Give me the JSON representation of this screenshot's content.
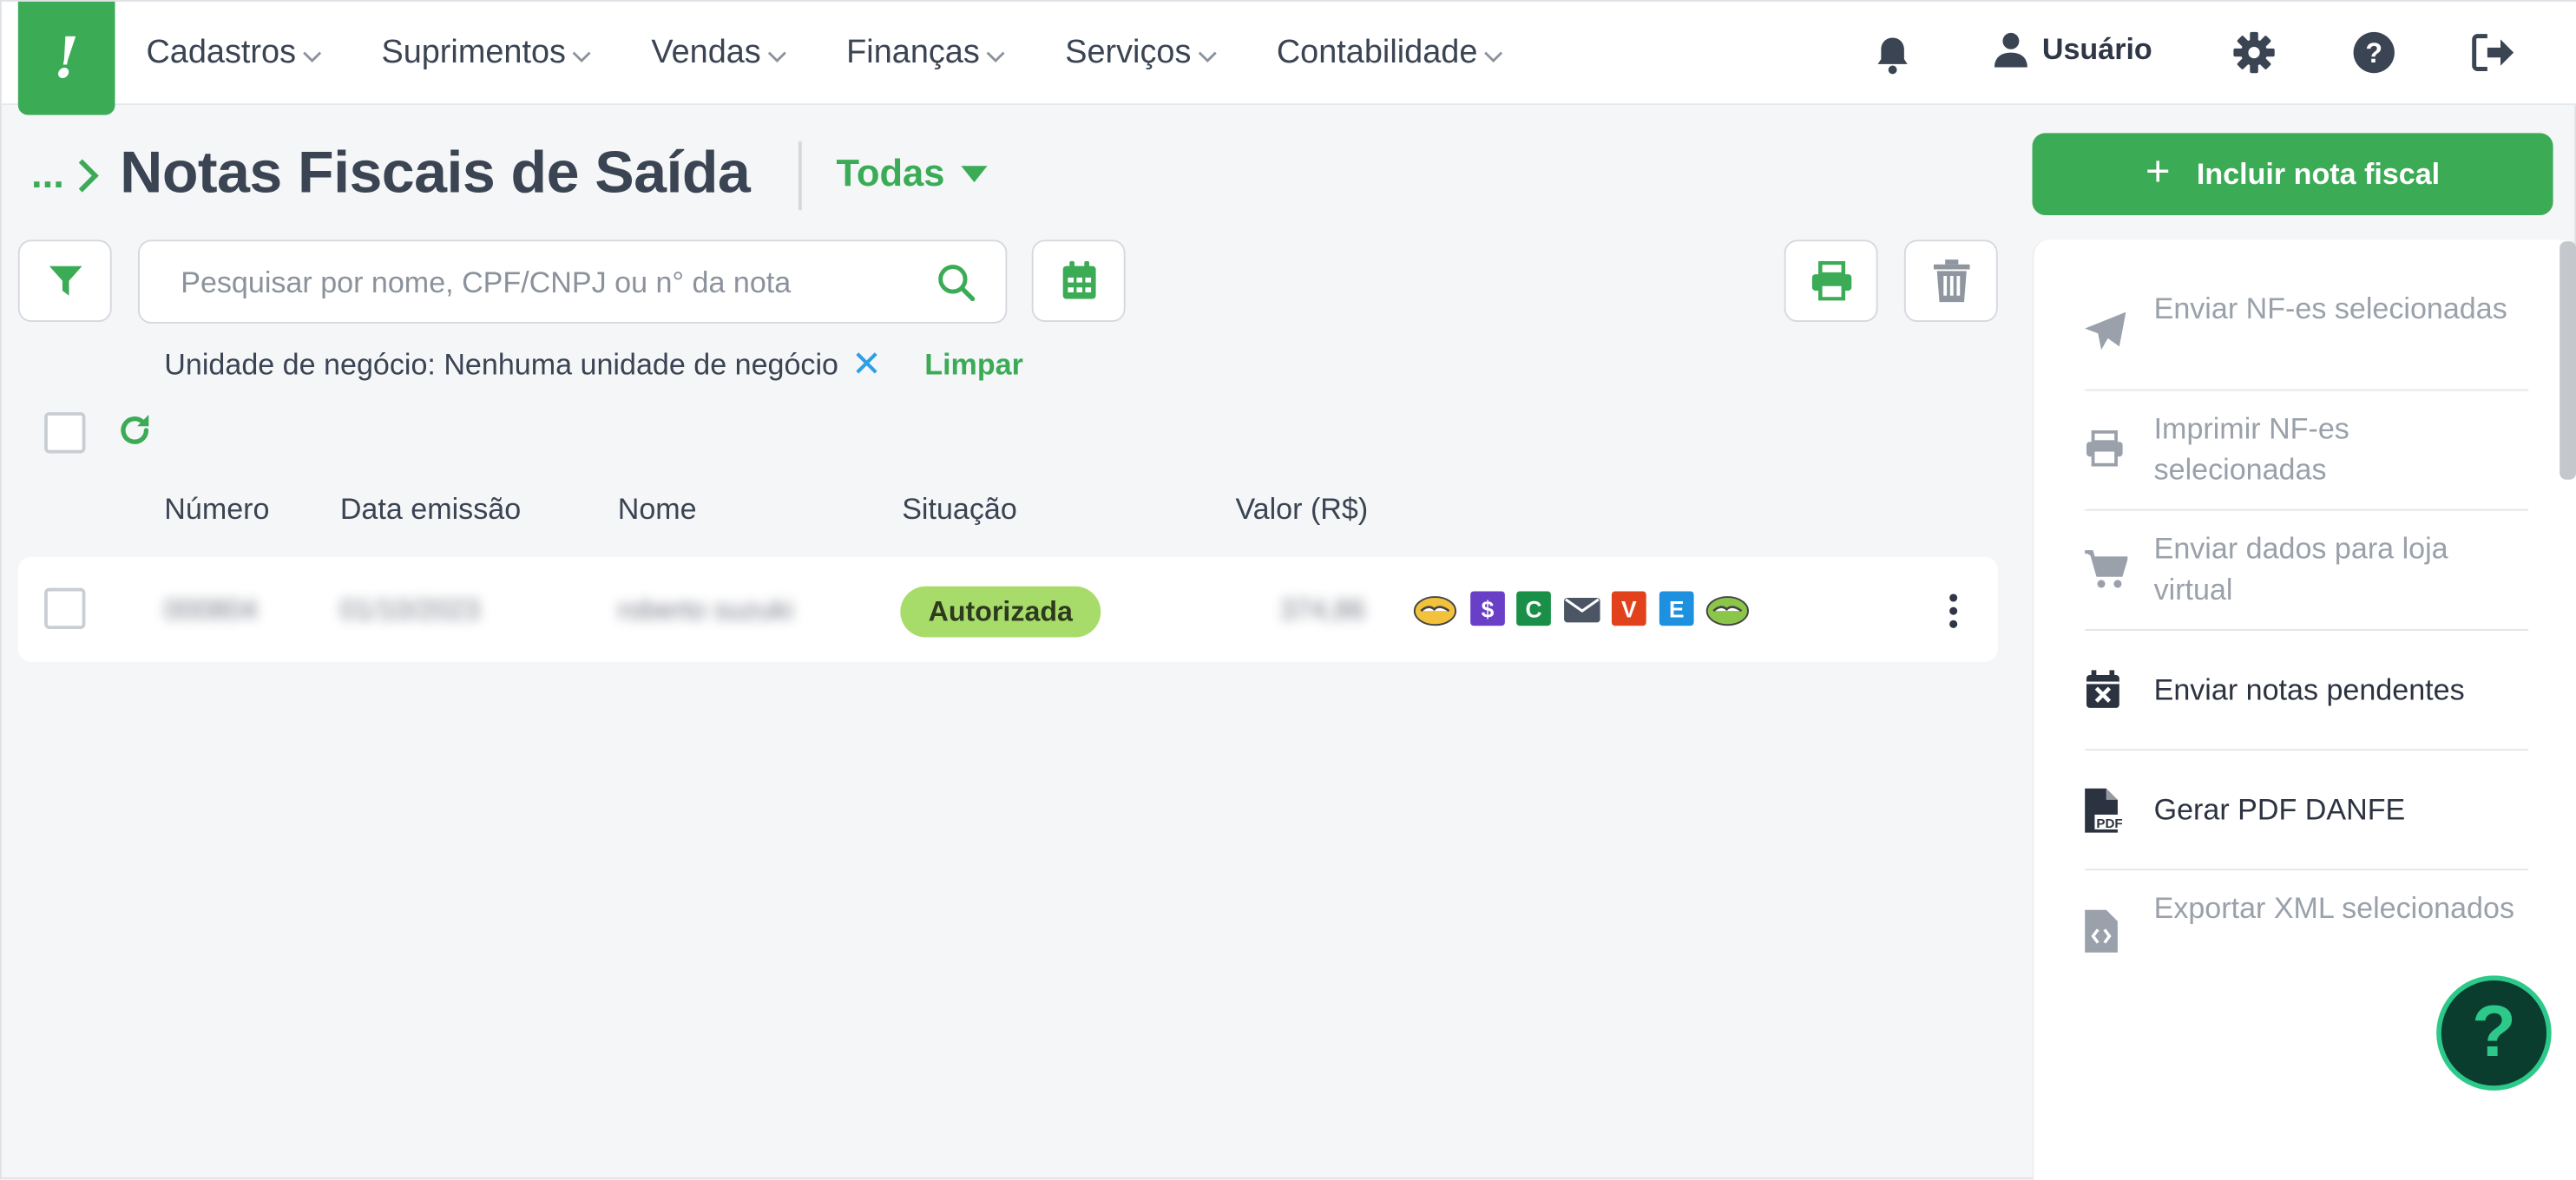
{
  "nav": {
    "logo_glyph": "!",
    "items": [
      {
        "label": "Cadastros"
      },
      {
        "label": "Suprimentos"
      },
      {
        "label": "Vendas"
      },
      {
        "label": "Finanças"
      },
      {
        "label": "Serviços"
      },
      {
        "label": "Contabilidade"
      }
    ],
    "user_label": "Usuário"
  },
  "header": {
    "breadcrumb": "...",
    "title": "Notas Fiscais de Saída",
    "filter_label": "Todas",
    "add_button_label": "Incluir nota fiscal",
    "add_button_plus": "+"
  },
  "search": {
    "placeholder": "Pesquisar por nome, CPF/CNPJ ou n° da nota",
    "value": ""
  },
  "active_filter": {
    "text": "Unidade de negócio: Nenhuma unidade de negócio",
    "remove_glyph": "✕",
    "clear_label": "Limpar"
  },
  "table": {
    "columns": [
      "Número",
      "Data emissão",
      "Nome",
      "Situação",
      "Valor (R$)"
    ],
    "rows": [
      {
        "numero": "000804",
        "data": "01/10/2023",
        "nome": "roberto suzuki",
        "situacao": "Autorizada",
        "valor": "374,86",
        "action_badges": [
          {
            "icon": "handshake-icon"
          },
          {
            "glyph": "$",
            "color": "#6a3fc8"
          },
          {
            "glyph": "C",
            "color": "#1a8f47"
          },
          {
            "icon": "envelope-icon"
          },
          {
            "glyph": "V",
            "color": "#e1421b"
          },
          {
            "glyph": "E",
            "color": "#1e90e0"
          },
          {
            "icon": "handshake-icon"
          }
        ]
      }
    ]
  },
  "side_panel": {
    "items": [
      {
        "label": "Enviar NF-es selecionadas",
        "icon": "paper-plane-icon",
        "enabled": false
      },
      {
        "label": "Imprimir NF-es selecionadas",
        "icon": "printer-icon",
        "enabled": false
      },
      {
        "label": "Enviar dados para loja virtual",
        "icon": "cart-icon",
        "enabled": false
      },
      {
        "label": "Enviar notas pendentes",
        "icon": "calendar-x-icon",
        "enabled": true
      },
      {
        "label": "Gerar PDF DANFE",
        "icon": "pdf-file-icon",
        "enabled": true
      },
      {
        "label": "Exportar XML selecionados",
        "icon": "code-file-icon",
        "enabled": false
      }
    ]
  },
  "help_fab_glyph": "?",
  "colors": {
    "brand_green": "#3bab56",
    "status_authorized": "#a8dc6a",
    "text_dark": "#3b4453",
    "text_disabled": "#9aa1aa",
    "help_fab_bg": "#0b3d2e",
    "help_fab_accent": "#2cc98a"
  }
}
